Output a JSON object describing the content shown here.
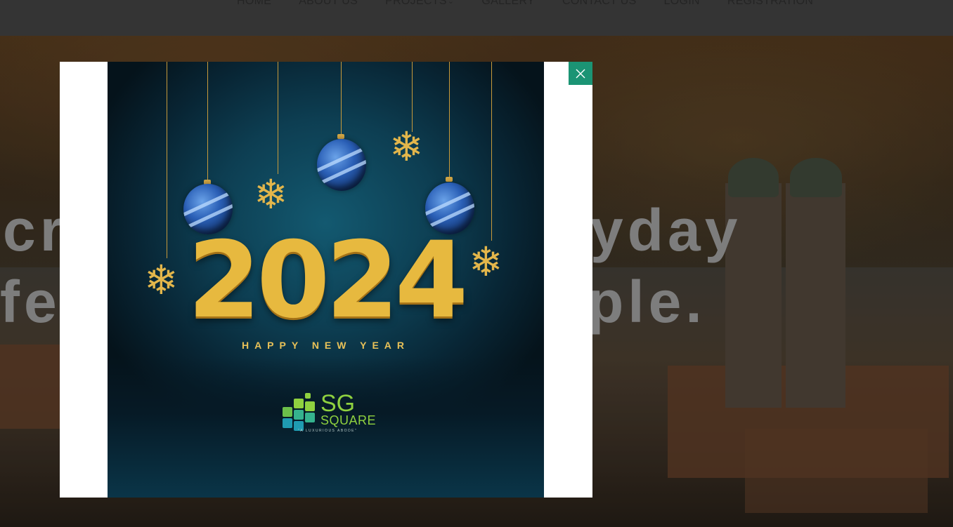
{
  "nav": {
    "items": [
      {
        "label": "HOME"
      },
      {
        "label": "ABOUT US"
      },
      {
        "label": "PROJECTS",
        "has_dropdown": true
      },
      {
        "label": "GALLERY"
      },
      {
        "label": "CONTACT US"
      },
      {
        "label": "LOGIN"
      },
      {
        "label": "REGISTRATION"
      }
    ],
    "dropdown_icon": "chevron-down-icon"
  },
  "hero": {
    "line1_left": "cr",
    "line1_right": "yday",
    "line2_left": "fe",
    "line2_right": "ple."
  },
  "modal": {
    "close_label": "×",
    "close_icon": "close-icon",
    "poster": {
      "year": "2024",
      "greeting": "HAPPY NEW YEAR",
      "logo_sg": "SG",
      "logo_square": "SQUARE",
      "logo_tagline": "\"A LUXURIOUS ABODE\""
    }
  },
  "colors": {
    "close_button": "#1b9474",
    "poster_gold": "#e7b93f",
    "logo_green": "#8fd13f",
    "modal_background": "#ffffff"
  }
}
